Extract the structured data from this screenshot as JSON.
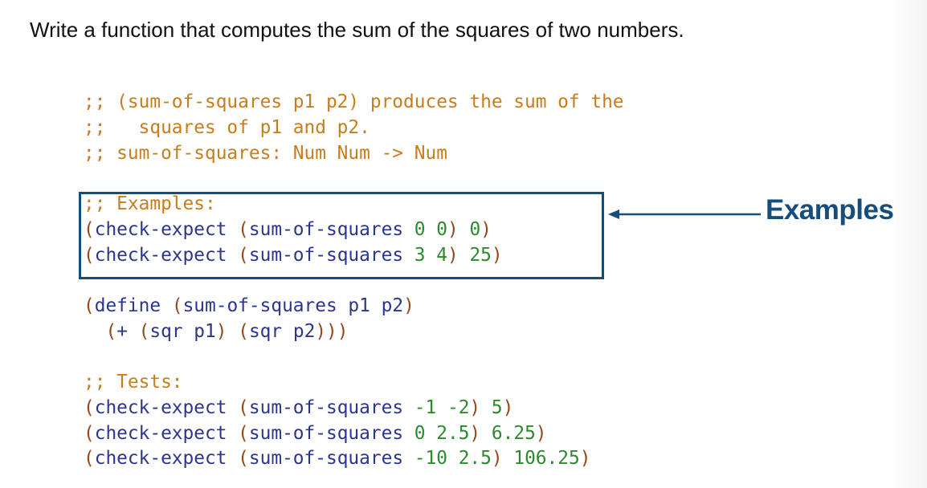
{
  "title": "Write a function that computes the sum of the squares of two numbers.",
  "colors": {
    "comment": "#c97c1b",
    "keyword": "#2a3591",
    "paren": "#96471c",
    "number": "#2b8a2b",
    "callout": "#154e7c"
  },
  "purpose": {
    "line1_semis": ";;",
    "line1_text": " (sum-of-squares p1 p2) produces the sum of the",
    "line2_semis": ";;",
    "line2_text": "   squares of p1 and p2.",
    "line3_semis": ";;",
    "line3_text": " sum-of-squares: Num Num -> Num"
  },
  "examples": {
    "header": ";; Examples:",
    "rows": [
      {
        "fn": "check-expect",
        "call": "sum-of-squares",
        "args": "0 0",
        "expected": "0"
      },
      {
        "fn": "check-expect",
        "call": "sum-of-squares",
        "args": "3 4",
        "expected": "25"
      }
    ]
  },
  "define": {
    "kw": "define",
    "name": "sum-of-squares p1 p2",
    "body_op": "+",
    "sqr1": "sqr p1",
    "sqr2": "sqr p2"
  },
  "tests": {
    "header": ";; Tests:",
    "rows": [
      {
        "fn": "check-expect",
        "call": "sum-of-squares",
        "args": "-1 -2",
        "expected": "5"
      },
      {
        "fn": "check-expect",
        "call": "sum-of-squares",
        "args": "0 2.5",
        "expected": "6.25"
      },
      {
        "fn": "check-expect",
        "call": "sum-of-squares",
        "args": "-10 2.5",
        "expected": "106.25"
      }
    ]
  },
  "callout": {
    "label": "Examples",
    "icon": "arrow-left-icon"
  },
  "syntax": {
    "open": "(",
    "close": ")",
    "space": " ",
    "indent": "  "
  }
}
